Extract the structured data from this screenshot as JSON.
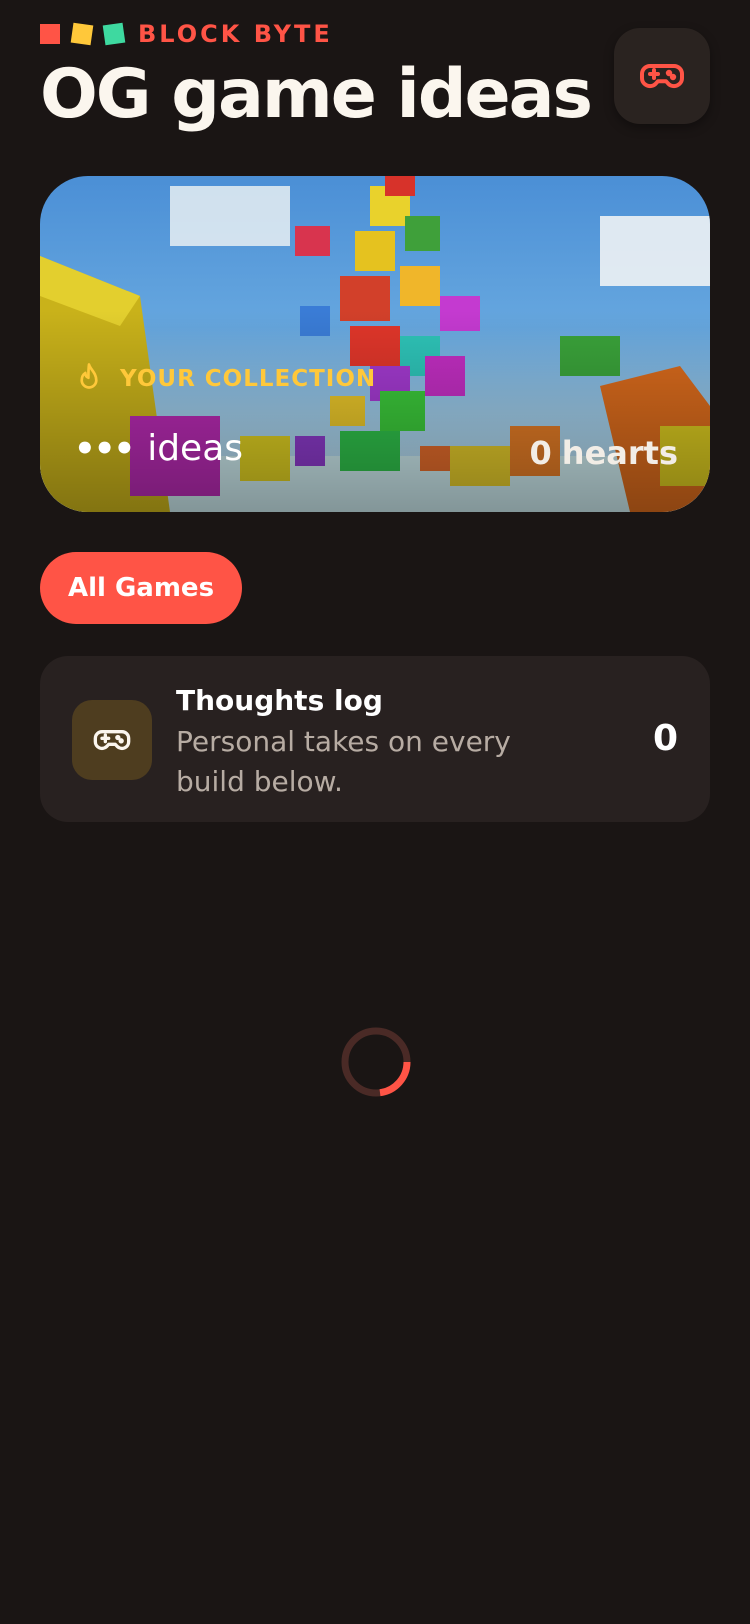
{
  "brand": {
    "name": "BLOCK BYTE",
    "colors": [
      "#ff5446",
      "#ffc83a",
      "#3ed9a0"
    ]
  },
  "header": {
    "title": "OG game ideas",
    "action_icon": "gamepad-icon"
  },
  "hero": {
    "collection_label": "YOUR COLLECTION",
    "collection_icon": "flame-icon",
    "ideas_count": "•••",
    "ideas_label": "ideas",
    "hearts_count": "0",
    "hearts_label": "hearts"
  },
  "filters": {
    "active_label": "All Games"
  },
  "card": {
    "icon": "gamepad-icon",
    "title": "Thoughts log",
    "description": "Personal takes on every build below.",
    "count": "0"
  },
  "status": {
    "loading": true
  },
  "colors": {
    "accent": "#ff5446",
    "background": "#1a1514",
    "highlight": "#ffc83a"
  }
}
